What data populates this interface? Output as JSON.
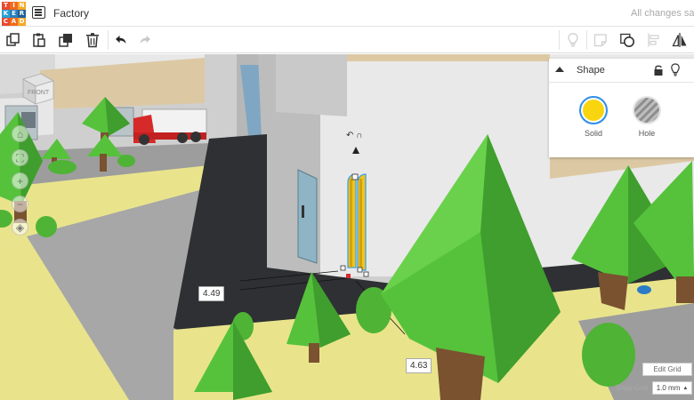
{
  "app": {
    "logo_letters": [
      "T",
      "I",
      "N",
      "K",
      "E",
      "R",
      "C",
      "A",
      "D"
    ],
    "logo_colors": [
      "#e84a2e",
      "#f26a1b",
      "#f9a825",
      "#2a9fd6",
      "#2b7fb8",
      "#1f5f99",
      "#e84a2e",
      "#f26a1b",
      "#f9a825"
    ],
    "design_title": "Factory",
    "save_status": "All changes saved"
  },
  "toolbar": {
    "left_tools": [
      "copy-icon",
      "paste-icon",
      "duplicate-icon",
      "delete-icon",
      "undo-icon",
      "redo-icon"
    ],
    "right_tools": [
      "lightbulb-icon",
      "notes-icon",
      "group-icon",
      "align-icon",
      "mirror-icon"
    ]
  },
  "viewport": {
    "view_cube_label": "FRONT",
    "nav": [
      "home-icon",
      "fit-icon",
      "zoom-in-icon",
      "zoom-out-icon",
      "orthographic-icon"
    ],
    "dimension_width": "4.49",
    "dimension_depth": "4.63",
    "rotation_hint": "↶ ∩"
  },
  "inspector": {
    "title": "Shape",
    "solid_label": "Solid",
    "hole_label": "Hole",
    "solid_color": "#f8d50f",
    "selection_color": "#2d8ff0"
  },
  "grid_controls": {
    "edit_grid_label": "Edit Grid",
    "snap_label": "Snap Grid",
    "snap_value": "1.0 mm"
  }
}
